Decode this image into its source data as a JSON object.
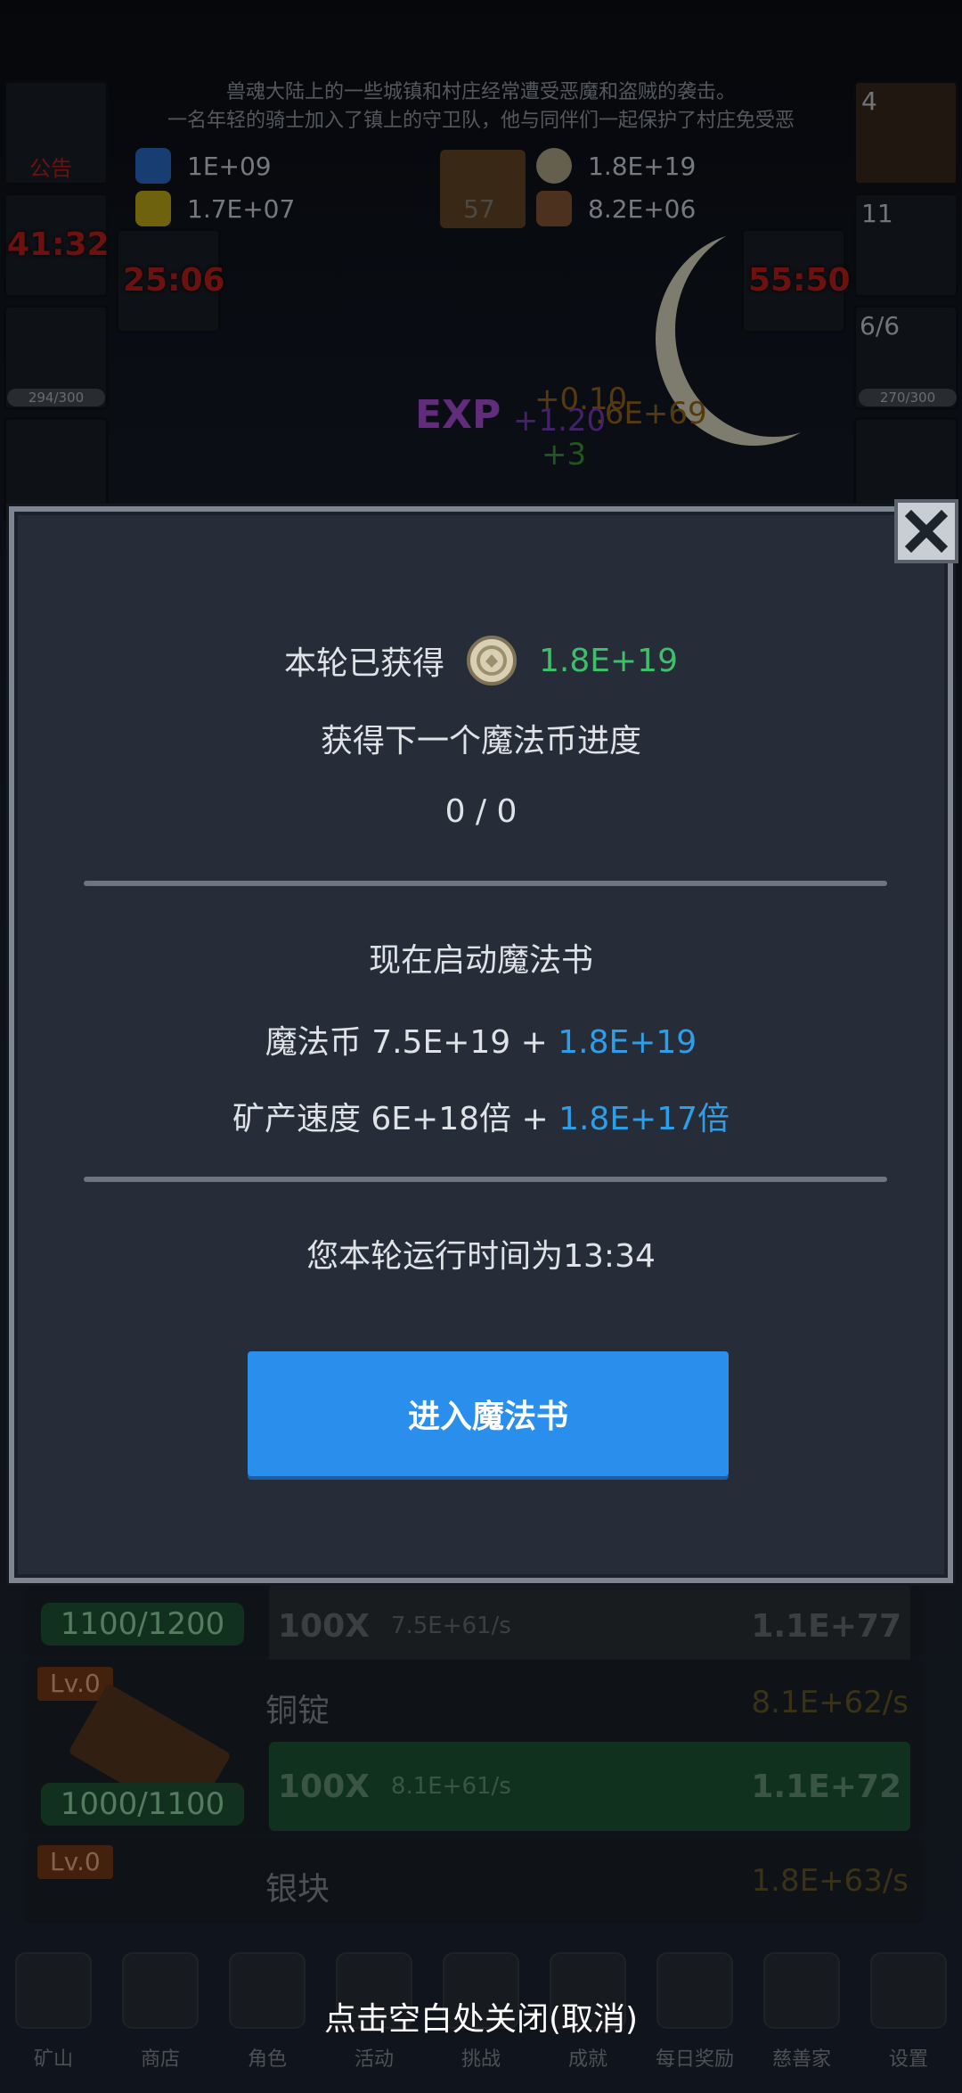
{
  "background": {
    "story_lines": [
      "兽魂大陆上的一些城镇和村庄经常遭受恶魔和盗贼的袭击。",
      "一名年轻的骑士加入了镇上的守卫队，他与同伴们一起保护了村庄免受恶"
    ],
    "resources": {
      "blue_potion": "1E+09",
      "yellow_potion": "1.7E+07",
      "coin": "1.8E+19",
      "meat": "8.2E+06",
      "book_level": "57"
    },
    "left_notice": "公告",
    "timer_left": "41:32",
    "timer_mid": "25:06",
    "timer_right": "55:50",
    "bar_left": "294/300",
    "bar_right": "270/300",
    "counter_right_top": "4",
    "counter_right_mid": "11",
    "counter_right_slots": "6/6",
    "float_texts": [
      "+0.10",
      "+1.20",
      ".6E+69",
      "+3"
    ],
    "mines": [
      {
        "capacity": "1100/1200",
        "multiplier": "100X",
        "rate": "7.5E+61/s",
        "cost": "1.1E+77"
      },
      {
        "level": "Lv.0",
        "name": "铜锭",
        "income": "8.1E+62/s",
        "capacity": "1000/1100",
        "multiplier": "100X",
        "rate": "8.1E+61/s",
        "cost": "1.1E+72"
      },
      {
        "level": "Lv.0",
        "name": "银块",
        "income": "1.8E+63/s"
      }
    ],
    "nav": [
      "矿山",
      "商店",
      "角色",
      "活动",
      "挑战",
      "成就",
      "每日奖励",
      "慈善家",
      "设置"
    ]
  },
  "modal": {
    "earned_label": "本轮已获得",
    "earned_value": "1.8E+19",
    "progress_label": "获得下一个魔法币进度",
    "progress_value": "0 / 0",
    "start_label": "现在启动魔法书",
    "coin_label": "魔法币 7.5E+19 + ",
    "coin_add": "1.8E+19",
    "speed_label": "矿产速度 6E+18倍 + ",
    "speed_add": "1.8E+17倍",
    "runtime": "您本轮运行时间为13:34",
    "enter_button": "进入魔法书"
  },
  "close_hint": "点击空白处关闭(取消)",
  "colors": {
    "accent_green": "#3fbf6a",
    "accent_blue": "#2f9ee9",
    "button_blue": "#2a8eed"
  }
}
